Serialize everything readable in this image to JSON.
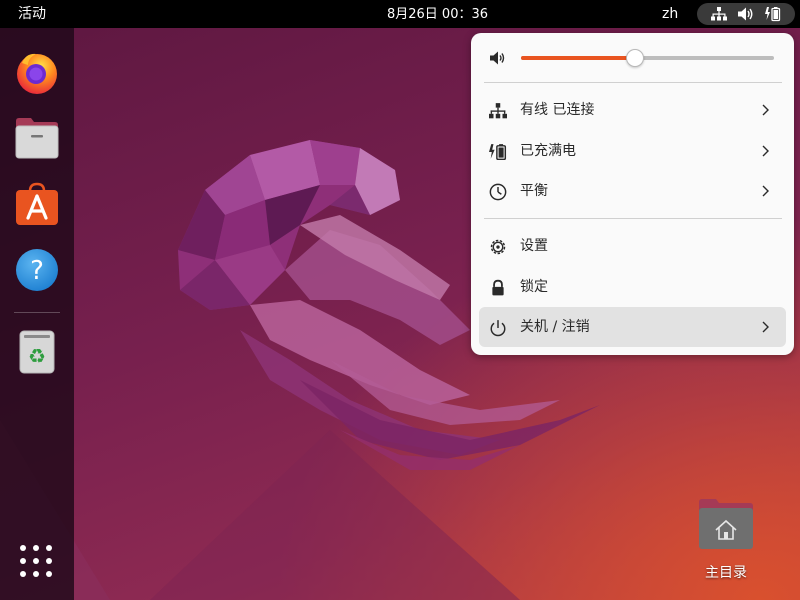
{
  "topbar": {
    "activities": "活动",
    "clock": "8月26日  00：36",
    "lang": "zh"
  },
  "dock": {
    "apps": [
      {
        "name": "firefox-icon"
      },
      {
        "name": "files-icon"
      },
      {
        "name": "app-center-icon"
      },
      {
        "name": "help-icon"
      },
      {
        "name": "trash-icon"
      }
    ]
  },
  "desktop": {
    "home_label": "主目录"
  },
  "menu": {
    "volume": 0.45,
    "items": [
      {
        "label": "有线 已连接",
        "icon": "wired-network-icon",
        "chevron": true
      },
      {
        "label": "已充满电",
        "icon": "battery-icon",
        "chevron": true
      },
      {
        "label": "平衡",
        "icon": "power-mode-icon",
        "chevron": true
      },
      {
        "label": "设置",
        "icon": "settings-icon",
        "chevron": false
      },
      {
        "label": "锁定",
        "icon": "lock-icon",
        "chevron": false
      },
      {
        "label": "关机 / 注销",
        "icon": "power-icon",
        "chevron": true
      }
    ]
  },
  "colors": {
    "accent": "#e95420",
    "menu_bg": "#fafafa",
    "topbar_bg": "#000000"
  }
}
